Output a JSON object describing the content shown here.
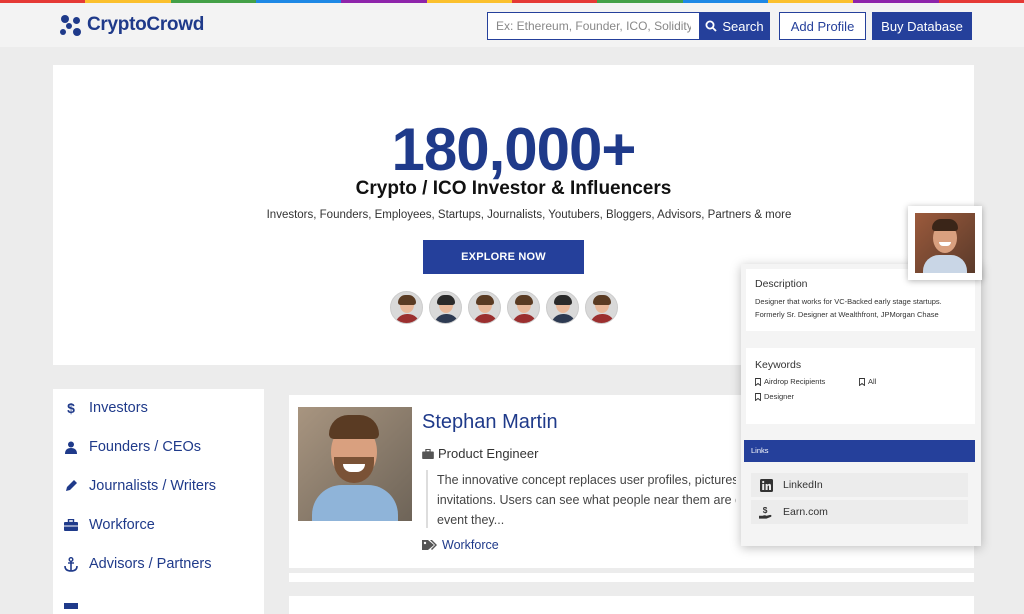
{
  "brand": {
    "name": "CryptoCrowd",
    "color": "#1f3a8a",
    "strip_colors": [
      "#e53935",
      "#fbc02d",
      "#43a047",
      "#1e88e5",
      "#8e24aa",
      "#fbc02d",
      "#e53935",
      "#43a047",
      "#1e88e5",
      "#fbc02d",
      "#8e24aa",
      "#e53935"
    ]
  },
  "header": {
    "search_placeholder": "Ex: Ethereum, Founder, ICO, Solidity e",
    "search_label": "Search",
    "add_profile_label": "Add Profile",
    "buy_database_label": "Buy Database"
  },
  "hero": {
    "count": "180,000+",
    "title": "Crypto / ICO Investor & Influencers",
    "subtitle": "Investors, Founders, Employees, Startups, Journalists, Youtubers, Bloggers, Advisors, Partners  & more",
    "cta_label": "EXPLORE NOW",
    "avatars": [
      {
        "hair": "#5a3b23",
        "body": "#9b2f2f"
      },
      {
        "hair": "#2a2a2a",
        "body": "#2d3a52"
      },
      {
        "hair": "#5a3b23",
        "body": "#9b2f2f"
      },
      {
        "hair": "#5a3b23",
        "body": "#9b2f2f"
      },
      {
        "hair": "#2a2a2a",
        "body": "#2d3a52"
      },
      {
        "hair": "#5a3b23",
        "body": "#9b2f2f"
      }
    ]
  },
  "sidebar": {
    "items": [
      {
        "label": "Investors",
        "icon": "dollar-icon"
      },
      {
        "label": "Founders / CEOs",
        "icon": "user-icon"
      },
      {
        "label": "Journalists / Writers",
        "icon": "pen-icon"
      },
      {
        "label": "Workforce",
        "icon": "briefcase-icon"
      },
      {
        "label": "Advisors / Partners",
        "icon": "anchor-icon"
      }
    ]
  },
  "profile": {
    "name": "Stephan Martin",
    "role": "Product Engineer",
    "description_lines": [
      "The innovative concept replaces user profiles, pictures a",
      "invitations. Users can see what people near them are do",
      "event they..."
    ],
    "tag": "Workforce"
  },
  "popup": {
    "description_heading": "Description",
    "description_lines": [
      "Designer that works for VC-Backed early stage startups.",
      "Formerly Sr. Designer at Wealthfront, JPMorgan Chase"
    ],
    "keywords_heading": "Keywords",
    "keywords": [
      "Airdrop Recipients",
      "All",
      "Designer"
    ],
    "links_heading": "Links",
    "links": [
      {
        "label": "LinkedIn",
        "icon": "linkedin-icon"
      },
      {
        "label": "Earn.com",
        "icon": "earn-icon"
      }
    ]
  }
}
